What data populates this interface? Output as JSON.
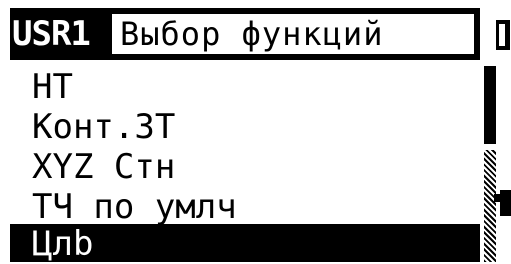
{
  "header": {
    "user_label": "USR1",
    "title": "Выбор функций"
  },
  "menu": {
    "items": [
      {
        "label": "НТ",
        "selected": false
      },
      {
        "label": "Конт.ЗТ",
        "selected": false
      },
      {
        "label": "XYZ Стн",
        "selected": false
      },
      {
        "label": "ТЧ по умлч",
        "selected": false
      },
      {
        "label": "Цлb",
        "selected": true
      }
    ]
  },
  "colors": {
    "foreground": "#000000",
    "background": "#ffffff"
  },
  "icons": {
    "corner": "battery-icon",
    "edge": "instrument-icon"
  }
}
